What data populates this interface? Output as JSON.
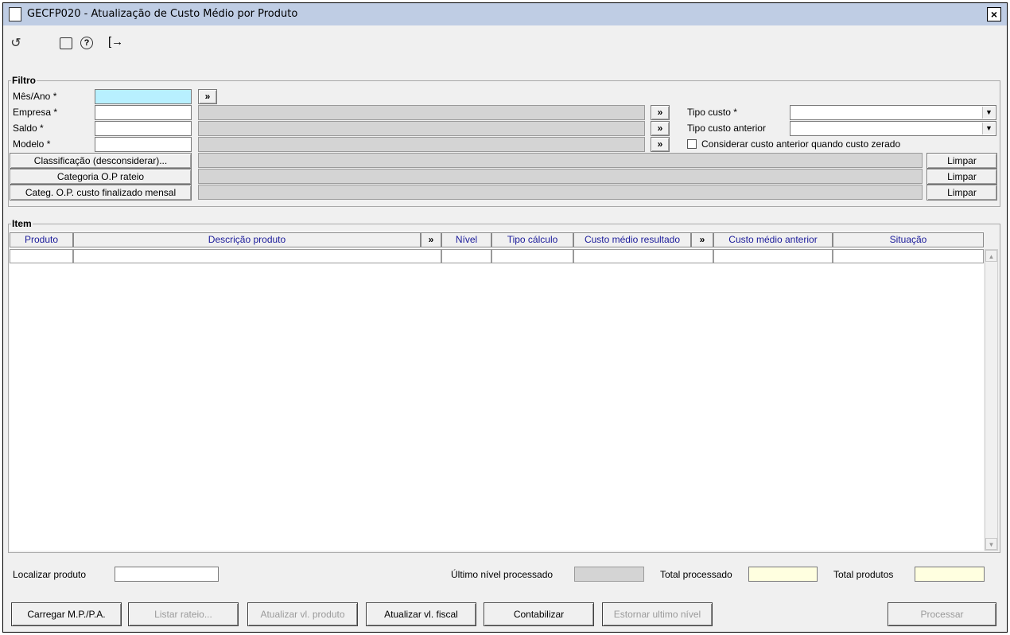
{
  "window": {
    "title": "GECFP020 - Atualização de Custo Médio por Produto",
    "close_label": "×"
  },
  "toolbar": {
    "undo_icon": "↺",
    "calendar_icon": "▭",
    "help_icon": "?",
    "exit_icon": "[→"
  },
  "filtro": {
    "legend": "Filtro",
    "mes_ano_label": "Mês/Ano *",
    "empresa_label": "Empresa *",
    "saldo_label": "Saldo *",
    "modelo_label": "Modelo *",
    "more_label": "»",
    "tipo_custo_label": "Tipo custo *",
    "tipo_custo_anterior_label": "Tipo custo anterior",
    "considerar_label": "Considerar custo anterior quando custo zerado",
    "classificacao_button": "Classificação (desconsiderar)...",
    "categoria_button": "Categoria O.P rateio",
    "categ_mensal_button": "Categ. O.P. custo finalizado mensal",
    "limpar_label": "Limpar"
  },
  "item": {
    "legend": "Item",
    "columns": {
      "produto": "Produto",
      "descricao": "Descrição produto",
      "more": "»",
      "nivel": "Nível",
      "tipo_calculo": "Tipo cálculo",
      "custo_resultado": "Custo médio resultado",
      "more2": "»",
      "custo_anterior": "Custo médio anterior",
      "situacao": "Situação"
    }
  },
  "footer": {
    "localizar_label": "Localizar produto",
    "ultimo_nivel_label": "Último nível processado",
    "total_processado_label": "Total processado",
    "total_produtos_label": "Total produtos"
  },
  "actions": {
    "carregar": "Carregar M.P./P.A.",
    "listar": "Listar rateio...",
    "atualizar_produto": "Atualizar vl. produto",
    "atualizar_fiscal": "Atualizar vl. fiscal",
    "contabilizar": "Contabilizar",
    "estornar": "Estornar ultimo nível",
    "processar": "Processar"
  }
}
